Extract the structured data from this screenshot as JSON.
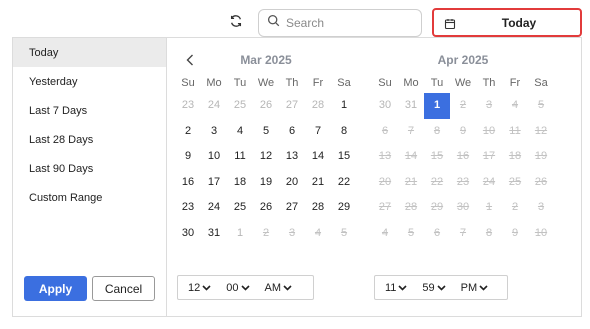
{
  "toolbar": {
    "search_placeholder": "Search",
    "date_button_label": "Today",
    "highlight_color": "#e23b3b",
    "accent_color": "#3b6fe0"
  },
  "presets": [
    "Today",
    "Yesterday",
    "Last 7 Days",
    "Last 28 Days",
    "Last 90 Days",
    "Custom Range"
  ],
  "active_preset": "Today",
  "buttons": {
    "apply": "Apply",
    "cancel": "Cancel"
  },
  "weekdays": [
    "Su",
    "Mo",
    "Tu",
    "We",
    "Th",
    "Fr",
    "Sa"
  ],
  "left_calendar": {
    "title": "Mar 2025",
    "days": [
      {
        "d": "23",
        "s": "muted"
      },
      {
        "d": "24",
        "s": "muted"
      },
      {
        "d": "25",
        "s": "muted"
      },
      {
        "d": "26",
        "s": "muted"
      },
      {
        "d": "27",
        "s": "muted"
      },
      {
        "d": "28",
        "s": "muted"
      },
      {
        "d": "1",
        "s": ""
      },
      {
        "d": "2",
        "s": ""
      },
      {
        "d": "3",
        "s": ""
      },
      {
        "d": "4",
        "s": ""
      },
      {
        "d": "5",
        "s": ""
      },
      {
        "d": "6",
        "s": ""
      },
      {
        "d": "7",
        "s": ""
      },
      {
        "d": "8",
        "s": ""
      },
      {
        "d": "9",
        "s": ""
      },
      {
        "d": "10",
        "s": ""
      },
      {
        "d": "11",
        "s": ""
      },
      {
        "d": "12",
        "s": ""
      },
      {
        "d": "13",
        "s": ""
      },
      {
        "d": "14",
        "s": ""
      },
      {
        "d": "15",
        "s": ""
      },
      {
        "d": "16",
        "s": ""
      },
      {
        "d": "17",
        "s": ""
      },
      {
        "d": "18",
        "s": ""
      },
      {
        "d": "19",
        "s": ""
      },
      {
        "d": "20",
        "s": ""
      },
      {
        "d": "21",
        "s": ""
      },
      {
        "d": "22",
        "s": ""
      },
      {
        "d": "23",
        "s": ""
      },
      {
        "d": "24",
        "s": ""
      },
      {
        "d": "25",
        "s": ""
      },
      {
        "d": "26",
        "s": ""
      },
      {
        "d": "27",
        "s": ""
      },
      {
        "d": "28",
        "s": ""
      },
      {
        "d": "29",
        "s": ""
      },
      {
        "d": "30",
        "s": ""
      },
      {
        "d": "31",
        "s": ""
      },
      {
        "d": "1",
        "s": "muted"
      },
      {
        "d": "2",
        "s": "disabled"
      },
      {
        "d": "3",
        "s": "disabled"
      },
      {
        "d": "4",
        "s": "disabled"
      },
      {
        "d": "5",
        "s": "disabled"
      }
    ]
  },
  "right_calendar": {
    "title": "Apr 2025",
    "days": [
      {
        "d": "30",
        "s": "muted"
      },
      {
        "d": "31",
        "s": "muted"
      },
      {
        "d": "1",
        "s": "selected"
      },
      {
        "d": "2",
        "s": "disabled"
      },
      {
        "d": "3",
        "s": "disabled"
      },
      {
        "d": "4",
        "s": "disabled"
      },
      {
        "d": "5",
        "s": "disabled"
      },
      {
        "d": "6",
        "s": "disabled"
      },
      {
        "d": "7",
        "s": "disabled"
      },
      {
        "d": "8",
        "s": "disabled"
      },
      {
        "d": "9",
        "s": "disabled"
      },
      {
        "d": "10",
        "s": "disabled"
      },
      {
        "d": "11",
        "s": "disabled"
      },
      {
        "d": "12",
        "s": "disabled"
      },
      {
        "d": "13",
        "s": "disabled"
      },
      {
        "d": "14",
        "s": "disabled"
      },
      {
        "d": "15",
        "s": "disabled"
      },
      {
        "d": "16",
        "s": "disabled"
      },
      {
        "d": "17",
        "s": "disabled"
      },
      {
        "d": "18",
        "s": "disabled"
      },
      {
        "d": "19",
        "s": "disabled"
      },
      {
        "d": "20",
        "s": "disabled"
      },
      {
        "d": "21",
        "s": "disabled"
      },
      {
        "d": "22",
        "s": "disabled"
      },
      {
        "d": "23",
        "s": "disabled"
      },
      {
        "d": "24",
        "s": "disabled"
      },
      {
        "d": "25",
        "s": "disabled"
      },
      {
        "d": "26",
        "s": "disabled"
      },
      {
        "d": "27",
        "s": "disabled"
      },
      {
        "d": "28",
        "s": "disabled"
      },
      {
        "d": "29",
        "s": "disabled"
      },
      {
        "d": "30",
        "s": "disabled"
      },
      {
        "d": "1",
        "s": "disabled"
      },
      {
        "d": "2",
        "s": "disabled"
      },
      {
        "d": "3",
        "s": "disabled"
      },
      {
        "d": "4",
        "s": "disabled"
      },
      {
        "d": "5",
        "s": "disabled"
      },
      {
        "d": "6",
        "s": "disabled"
      },
      {
        "d": "7",
        "s": "disabled"
      },
      {
        "d": "8",
        "s": "disabled"
      },
      {
        "d": "9",
        "s": "disabled"
      },
      {
        "d": "10",
        "s": "disabled"
      }
    ]
  },
  "time_start": {
    "hour": "12",
    "minute": "00",
    "ampm": "AM"
  },
  "time_end": {
    "hour": "11",
    "minute": "59",
    "ampm": "PM"
  },
  "icons": {
    "refresh": "refresh-icon",
    "search": "search-icon",
    "calendar": "calendar-icon",
    "prev": "chevron-left-icon",
    "dropdown": "chevron-down-icon"
  }
}
